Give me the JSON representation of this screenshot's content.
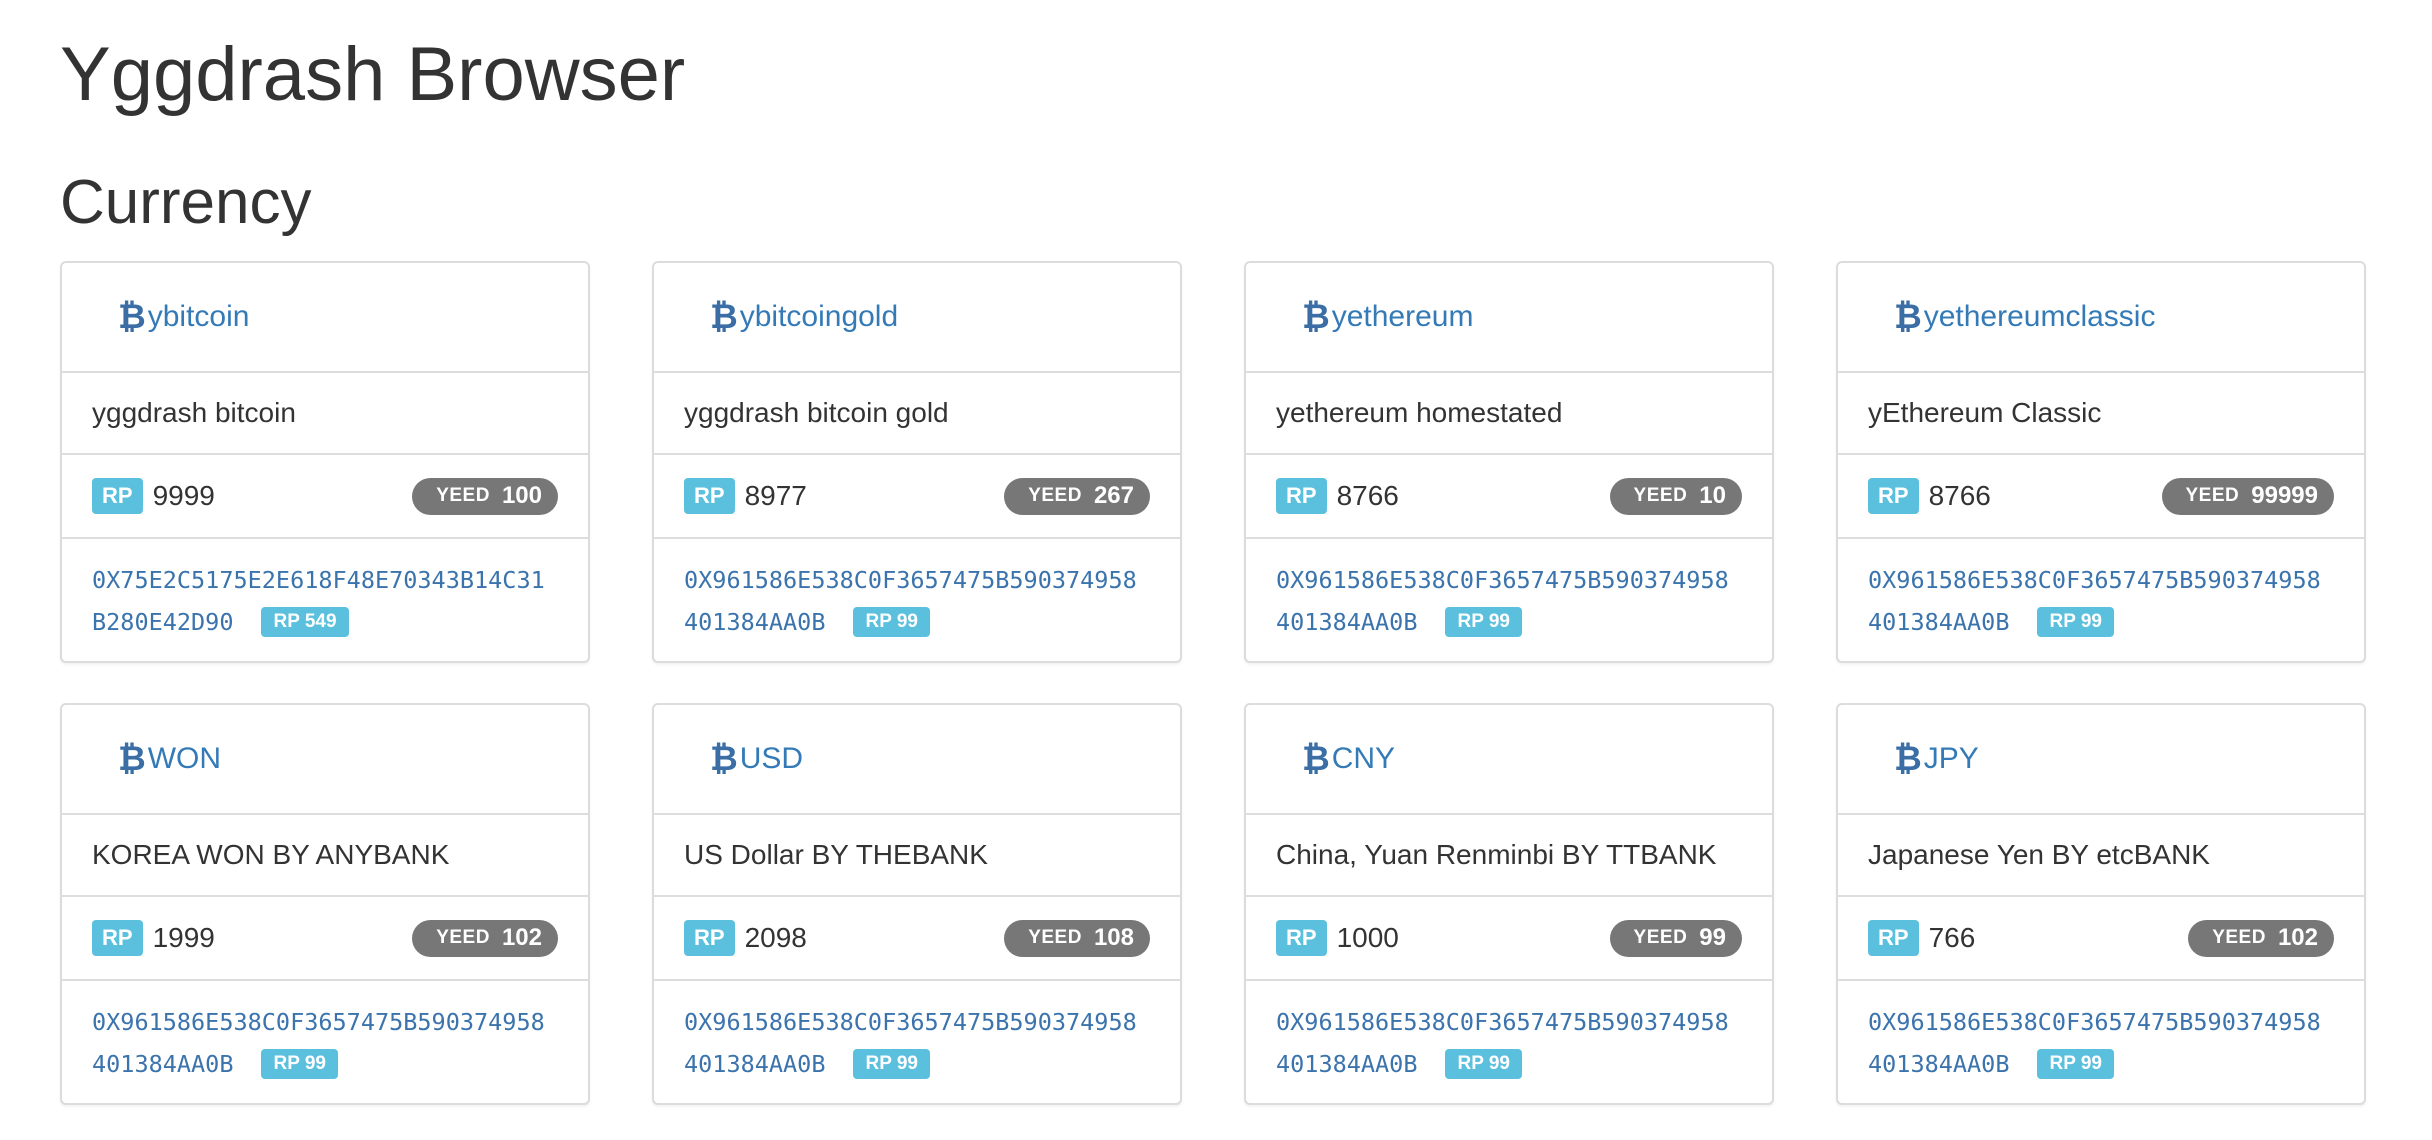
{
  "page": {
    "title": "Yggdrash Browser",
    "section_title": "Currency"
  },
  "icons": {
    "coin": "bitcoin-icon"
  },
  "colors": {
    "link": "#337ab7",
    "rp_badge": "#5bc0de",
    "yeed_badge": "#777777",
    "address": "#3b73ad"
  },
  "cards": [
    {
      "symbol": "ybitcoin",
      "description": "yggdrash bitcoin",
      "rp_label": "RP",
      "rp_value": "9999",
      "yeed_label": "YEED",
      "yeed_value": "100",
      "address_line1": "0X75E2C5175E2E618F48E70343B14C31",
      "address_line2": "B280E42D90",
      "address_rp": "RP 549"
    },
    {
      "symbol": "ybitcoingold",
      "description": "yggdrash bitcoin gold",
      "rp_label": "RP",
      "rp_value": "8977",
      "yeed_label": "YEED",
      "yeed_value": "267",
      "address_line1": "0X961586E538C0F3657475B590374958",
      "address_line2": "401384AA0B",
      "address_rp": "RP 99"
    },
    {
      "symbol": "yethereum",
      "description": "yethereum homestated",
      "rp_label": "RP",
      "rp_value": "8766",
      "yeed_label": "YEED",
      "yeed_value": "10",
      "address_line1": "0X961586E538C0F3657475B590374958",
      "address_line2": "401384AA0B",
      "address_rp": "RP 99"
    },
    {
      "symbol": "yethereumclassic",
      "description": "yEthereum Classic",
      "rp_label": "RP",
      "rp_value": "8766",
      "yeed_label": "YEED",
      "yeed_value": "99999",
      "address_line1": "0X961586E538C0F3657475B590374958",
      "address_line2": "401384AA0B",
      "address_rp": "RP 99"
    },
    {
      "symbol": "WON",
      "description": "KOREA WON BY ANYBANK",
      "rp_label": "RP",
      "rp_value": "1999",
      "yeed_label": "YEED",
      "yeed_value": "102",
      "address_line1": "0X961586E538C0F3657475B590374958",
      "address_line2": "401384AA0B",
      "address_rp": "RP 99"
    },
    {
      "symbol": "USD",
      "description": "US Dollar BY THEBANK",
      "rp_label": "RP",
      "rp_value": "2098",
      "yeed_label": "YEED",
      "yeed_value": "108",
      "address_line1": "0X961586E538C0F3657475B590374958",
      "address_line2": "401384AA0B",
      "address_rp": "RP 99"
    },
    {
      "symbol": "CNY",
      "description": "China, Yuan Renminbi BY TTBANK",
      "rp_label": "RP",
      "rp_value": "1000",
      "yeed_label": "YEED",
      "yeed_value": "99",
      "address_line1": "0X961586E538C0F3657475B590374958",
      "address_line2": "401384AA0B",
      "address_rp": "RP 99"
    },
    {
      "symbol": "JPY",
      "description": "Japanese Yen BY etcBANK",
      "rp_label": "RP",
      "rp_value": "766",
      "yeed_label": "YEED",
      "yeed_value": "102",
      "address_line1": "0X961586E538C0F3657475B590374958",
      "address_line2": "401384AA0B",
      "address_rp": "RP 99"
    }
  ]
}
